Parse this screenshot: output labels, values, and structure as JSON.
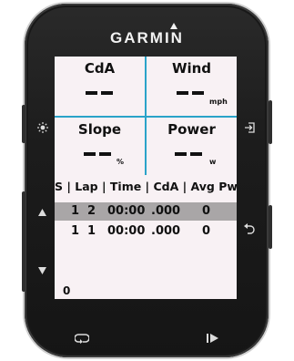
{
  "device": {
    "brand": "GARMIN"
  },
  "fields": [
    {
      "label": "CdA",
      "value": "--",
      "unit": ""
    },
    {
      "label": "Wind",
      "value": "--",
      "unit": "mph"
    },
    {
      "label": "Slope",
      "value": "--",
      "unit": "%"
    },
    {
      "label": "Power",
      "value": "--",
      "unit": "w"
    }
  ],
  "lap_table": {
    "header": "S | Lap | Time | CdA | Avg Pwr",
    "rows": [
      {
        "s": "1",
        "lap": "2",
        "time": "00:00",
        "cda": ".000",
        "avg_pwr": "0",
        "selected": true
      },
      {
        "s": "1",
        "lap": "1",
        "time": "00:00",
        "cda": ".000",
        "avg_pwr": "0",
        "selected": false
      }
    ]
  },
  "footer_value": "0",
  "buttons": {
    "light": "light-icon",
    "enter": "enter-icon",
    "up": "up-arrow-icon",
    "down": "down-arrow-icon",
    "back": "back-icon",
    "lap": "lap-icon",
    "start_stop": "start-stop-icon"
  },
  "colors": {
    "grid_lines": "#2aa3c9",
    "screen_bg": "#f8f1f4",
    "selected_row": "#a9a6a7",
    "bezel": "#1c1c1c"
  }
}
